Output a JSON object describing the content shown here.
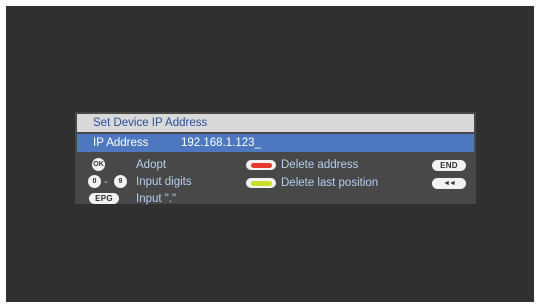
{
  "dialog": {
    "title": "Set Device IP Address",
    "ip_label": "IP Address",
    "ip_value": "192.168.1.123_"
  },
  "help": {
    "ok_key": "OK",
    "adopt": "Adopt",
    "digit_from": "0",
    "digit_sep": "-",
    "digit_to": "9",
    "input_digits": "Input digits",
    "epg_key": "EPG",
    "input_dot": "Input \".\"",
    "delete_address": "Delete address",
    "delete_last_position": "Delete last position",
    "end_key": "END",
    "rewind_key": "◄◄"
  },
  "colors": {
    "title_text": "#2a4f98",
    "selected_row": "#4d78bf",
    "help_text": "#b5cff2",
    "red_key": "#e8372c",
    "yellow_key": "#c9df2a"
  }
}
